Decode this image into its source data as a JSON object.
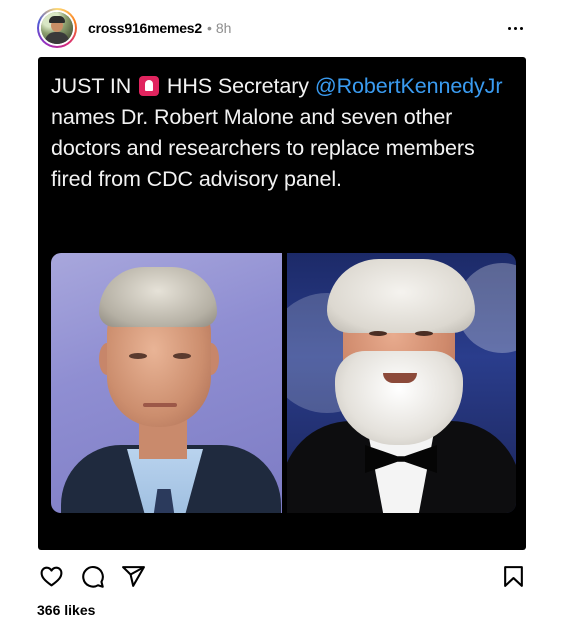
{
  "post": {
    "username": "cross916memes2",
    "separator": "•",
    "time": "8h",
    "caption_parts": {
      "lead": "JUST IN",
      "after_emoji": " HHS Secretary ",
      "mention": "@RobertKennedyJr",
      "rest": " names Dr. Robert Malone and seven other doctors and researchers to replace members fired from CDC advisory panel."
    },
    "emoji_icon": "police-siren-emoji",
    "likes": "366 likes"
  },
  "icons": {
    "more": "more-options-icon",
    "like": "heart-icon",
    "comment": "comment-icon",
    "share": "share-icon",
    "save": "bookmark-icon"
  },
  "colors": {
    "mention": "#3a9bf0",
    "image_bg": "#000000",
    "secondary_text": "#8e8e8e"
  }
}
